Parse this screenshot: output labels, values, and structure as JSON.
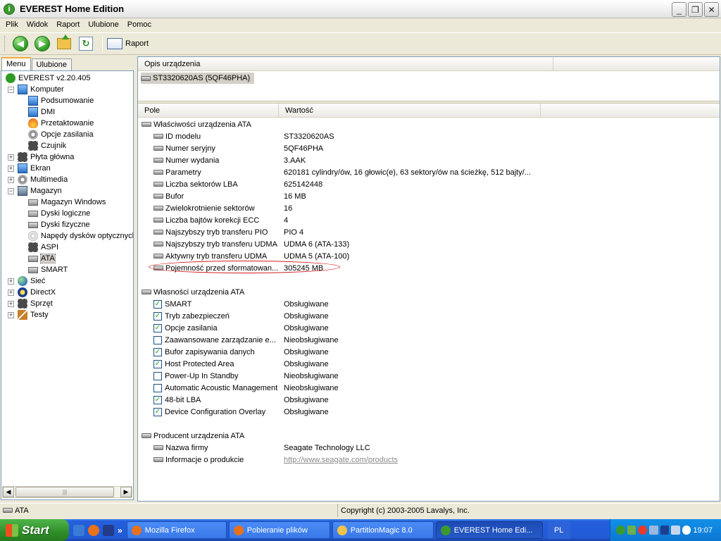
{
  "window": {
    "title": "EVEREST Home Edition",
    "controls": {
      "minimize": "_",
      "maximize": "❐",
      "close": "✕"
    }
  },
  "menubar": {
    "items": [
      "Plik",
      "Widok",
      "Raport",
      "Ulubione",
      "Pomoc"
    ]
  },
  "toolbar": {
    "report_label": "Raport"
  },
  "left_tabs": [
    {
      "label": "Menu",
      "active": true
    },
    {
      "label": "Ulubione",
      "active": false
    }
  ],
  "tree": [
    {
      "label": "EVEREST v2.20.405",
      "level": 0,
      "icon": "info-icon",
      "expander": ""
    },
    {
      "label": "Komputer",
      "level": 1,
      "icon": "computer-icon",
      "expander": "−"
    },
    {
      "label": "Podsumowanie",
      "level": 2,
      "icon": "computer-icon",
      "expander": ""
    },
    {
      "label": "DMI",
      "level": 2,
      "icon": "computer-icon",
      "expander": ""
    },
    {
      "label": "Przetaktowanie",
      "level": 2,
      "icon": "flame-icon",
      "expander": ""
    },
    {
      "label": "Opcje zasilania",
      "level": 2,
      "icon": "gear-icon",
      "expander": ""
    },
    {
      "label": "Czujnik",
      "level": 2,
      "icon": "sensor-icon",
      "expander": ""
    },
    {
      "label": "Płyta główna",
      "level": 1,
      "icon": "motherboard-icon",
      "expander": "+"
    },
    {
      "label": "Ekran",
      "level": 1,
      "icon": "monitor-icon",
      "expander": "+"
    },
    {
      "label": "Multimedia",
      "level": 1,
      "icon": "multimedia-icon",
      "expander": "+"
    },
    {
      "label": "Magazyn",
      "level": 1,
      "icon": "storage-icon",
      "expander": "−"
    },
    {
      "label": "Magazyn Windows",
      "level": 2,
      "icon": "disk-icon",
      "expander": ""
    },
    {
      "label": "Dyski logiczne",
      "level": 2,
      "icon": "disk-icon",
      "expander": ""
    },
    {
      "label": "Dyski fizyczne",
      "level": 2,
      "icon": "disk-icon",
      "expander": ""
    },
    {
      "label": "Napędy dysków optycznych",
      "level": 2,
      "icon": "cd-icon",
      "expander": ""
    },
    {
      "label": "ASPI",
      "level": 2,
      "icon": "aspi-icon",
      "expander": ""
    },
    {
      "label": "ATA",
      "level": 2,
      "icon": "disk-icon",
      "expander": "",
      "selected": true
    },
    {
      "label": "SMART",
      "level": 2,
      "icon": "disk-icon",
      "expander": ""
    },
    {
      "label": "Sieć",
      "level": 1,
      "icon": "globe-icon",
      "expander": "+"
    },
    {
      "label": "DirectX",
      "level": 1,
      "icon": "directx-icon",
      "expander": "+"
    },
    {
      "label": "Sprzęt",
      "level": 1,
      "icon": "hardware-icon",
      "expander": "+"
    },
    {
      "label": "Testy",
      "level": 1,
      "icon": "hourglass-icon",
      "expander": "+"
    }
  ],
  "device_panel": {
    "header": "Opis urządzenia",
    "device": "ST3320620AS (5QF46PHA)"
  },
  "grid": {
    "col_field": "Pole",
    "col_value": "Wartość",
    "sections": [
      {
        "title": "Właściwości urządzenia ATA",
        "rows": [
          {
            "field": "ID modelu",
            "value": "ST3320620AS"
          },
          {
            "field": "Numer seryjny",
            "value": "5QF46PHA"
          },
          {
            "field": "Numer wydania",
            "value": "3.AAK"
          },
          {
            "field": "Parametry",
            "value": "620181 cylindry/ów, 16 głowic(e), 63 sektory/ów na ścieżkę, 512 bajty/..."
          },
          {
            "field": "Liczba sektorów LBA",
            "value": "625142448"
          },
          {
            "field": "Bufor",
            "value": "16 MB"
          },
          {
            "field": "Zwielokrotnienie sektorów",
            "value": "16"
          },
          {
            "field": "Liczba bajtów korekcji ECC",
            "value": "4"
          },
          {
            "field": "Najszybszy tryb transferu PIO",
            "value": "PIO 4"
          },
          {
            "field": "Najszybszy tryb transferu UDMA",
            "value": "UDMA 6 (ATA-133)"
          },
          {
            "field": "Aktywny tryb transferu UDMA",
            "value": "UDMA 5 (ATA-100)"
          },
          {
            "field": "Pojemność przed sformatowan...",
            "value": "305245 MB",
            "highlighted": true
          }
        ]
      },
      {
        "title": "Własności urządzenia ATA",
        "rows": [
          {
            "field": "SMART",
            "value": "Obsługiwane",
            "checked": true
          },
          {
            "field": "Tryb zabezpieczeń",
            "value": "Obsługiwane",
            "checked": true
          },
          {
            "field": "Opcje zasilania",
            "value": "Obsługiwane",
            "checked": true
          },
          {
            "field": "Zaawansowane zarządzanie e...",
            "value": "Nieobsługiwane",
            "checked": false
          },
          {
            "field": "Bufor zapisywania danych",
            "value": "Obsługiwane",
            "checked": true
          },
          {
            "field": "Host Protected Area",
            "value": "Obsługiwane",
            "checked": true
          },
          {
            "field": "Power-Up In Standby",
            "value": "Nieobsługiwane",
            "checked": false
          },
          {
            "field": "Automatic Acoustic Management",
            "value": "Nieobsługiwane",
            "checked": false
          },
          {
            "field": "48-bit LBA",
            "value": "Obsługiwane",
            "checked": true
          },
          {
            "field": "Device Configuration Overlay",
            "value": "Obsługiwane",
            "checked": true
          }
        ]
      },
      {
        "title": "Producent urządzenia ATA",
        "rows": [
          {
            "field": "Nazwa firmy",
            "value": "Seagate Technology LLC"
          },
          {
            "field": "Informacje o produkcie",
            "value": "http://www.seagate.com/products",
            "link": true
          }
        ]
      }
    ]
  },
  "status": {
    "left": "ATA",
    "right": "Copyright (c) 2003-2005 Lavalys, Inc."
  },
  "taskbar": {
    "start_label": "Start",
    "quicklaunch_more": "»",
    "tasks": [
      {
        "label": "Mozilla Firefox",
        "icon_color": "#e8711c",
        "active": false
      },
      {
        "label": "Pobieranie plików",
        "icon_color": "#e8711c",
        "active": false
      },
      {
        "label": "PartitionMagic 8.0",
        "icon_color": "#f1c24a",
        "active": false
      },
      {
        "label": "EVEREST Home Edi...",
        "icon_color": "#3b9a2f",
        "active": true
      }
    ],
    "language": "PL",
    "clock": "19:07"
  },
  "colors": {
    "selection_ellipse": "#d62020",
    "check_mark": "#21a121",
    "taskbar_blue": "#245edb",
    "start_green": "#2f8e28"
  }
}
